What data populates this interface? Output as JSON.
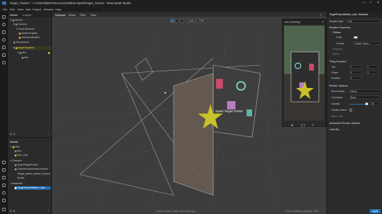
{
  "window": {
    "title": "Target_Tracker* - C:/Users/MyPC/Documents/Meta Spark/Target_Tracker - Meta Spark Studio",
    "controls": [
      "—",
      "□",
      "✕"
    ]
  },
  "menu": [
    "File",
    "Edit",
    "View",
    "Add",
    "Project",
    "Window",
    "Help"
  ],
  "scene_panel": {
    "tabs": [
      "Scene",
      "Layers"
    ],
    "items": [
      {
        "label": "Device"
      },
      {
        "label": "Camera"
      },
      {
        "label": "Focal Distance"
      },
      {
        "label": "ambientLight0"
      },
      {
        "label": "directionalLight0"
      },
      {
        "label": "Microphone"
      },
      {
        "label": "targetTracker0"
      },
      {
        "label": "Box"
      },
      {
        "label": "Box"
      }
    ]
  },
  "assets_panel": {
    "title": "Assets",
    "items": [
      {
        "label": "Star",
        "selected": false
      },
      {
        "label": "Box",
        "selected": false
      },
      {
        "label": "Star_mat",
        "selected": false
      },
      {
        "label": "Textures",
        "selected": false
      },
      {
        "label": "SparkTargetPoster",
        "selected": false
      },
      {
        "label": "Default environment texture",
        "selected": false
      },
      {
        "label": "Target_frame_marker_texture",
        "selected": false
      },
      {
        "label": "Empty",
        "selected": false
      },
      {
        "label": "Materials",
        "selected": false
      },
      {
        "label": "TargetFrameMarker_mat",
        "selected": true
      }
    ]
  },
  "viewport": {
    "tabs": [
      "Viewport",
      "Mode",
      "Filter",
      "View"
    ],
    "toolbar": [
      "Local",
      "Pivot"
    ],
    "user_panel_title": "User (Sharing)",
    "poster_text": "Spark Target Poster",
    "status": "Camera: Back • View: User (Sharing)",
    "status_right": "Frame rendering capacity: 100%"
  },
  "properties": {
    "header": "TargetFrameMarker_mat • Material",
    "shader_type_label": "Shader Type",
    "shader_type_value": "Flat",
    "sections": {
      "shader_properties": "Shader Properties",
      "diffuse": "Diffuse",
      "tiling_function": "Tiling Function",
      "render_options": "Render Options",
      "advanced": "Advanced Render Options",
      "used_by": "Used By"
    },
    "labels": {
      "color": "Color",
      "texture": "Texture",
      "emissive": "Emissive",
      "alpha": "Alpha",
      "tile": "Tile",
      "offset": "Offset",
      "rotation": "Rotation",
      "blend_mode": "Blend Mode",
      "cull_mode": "Cull Mode",
      "opacity": "Opacity",
      "double_sided": "Double Sided",
      "alpha_test": "Alpha Test"
    },
    "values": {
      "texture": "Target_frame...",
      "tile_x": "1",
      "tile_y": "1",
      "offset_x": "0",
      "offset_y": "0",
      "rotation": "0",
      "blend_mode": "Alpha",
      "cull_mode": "Back",
      "opacity": "91"
    },
    "apply_label": "Apply"
  },
  "colors": {
    "accent": "#1f6fb5",
    "star": "#c9c32a",
    "background": "#3d3d3d"
  }
}
